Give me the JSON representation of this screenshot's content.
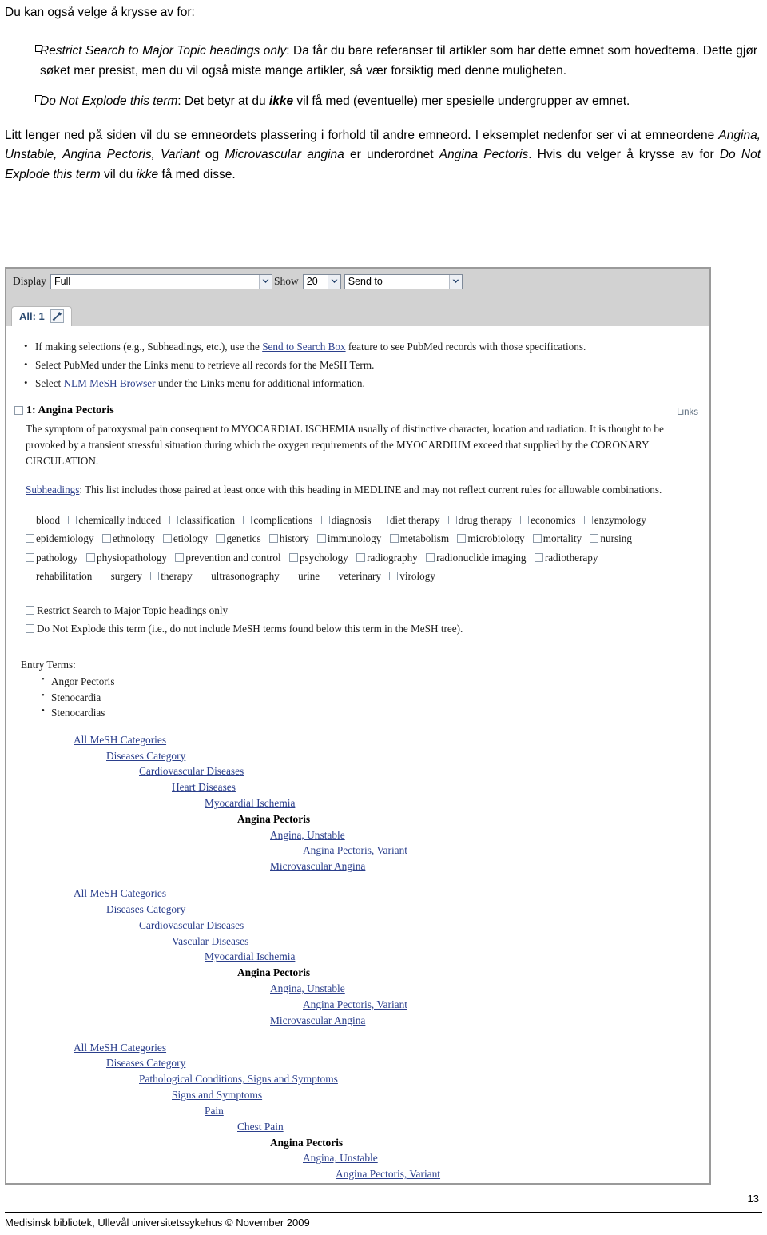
{
  "document": {
    "lead": "Du kan også velge å krysse av for:",
    "bullets": [
      {
        "term": "Restrict Search to Major Topic headings only",
        "text": ": Da får du bare referanser til artikler som har dette emnet som hovedtema. Dette gjør søket mer presist, men du vil også miste mange artikler, så vær forsiktig med denne muligheten."
      },
      {
        "term": "Do Not Explode this term",
        "text_a": ": Det betyr at du ",
        "emph": "ikke",
        "text_b": " vil få med (eventuelle) mer spesielle undergrupper av emnet."
      }
    ],
    "paragraph": {
      "p1": "Litt lenger ned på siden vil du se emneordets plassering i forhold til andre emneord. I eksemplet nedenfor ser vi at emneordene ",
      "terms1": "Angina, Unstable, Angina Pectoris, Variant",
      "p2": " og ",
      "terms2": "Microvascular angina",
      "p3": " er underordnet ",
      "terms3": "Angina Pectoris",
      "p4": ". Hvis du velger å krysse av for ",
      "terms4": "Do Not Explode this term",
      "p5": " vil du ",
      "emph": "ikke",
      "p6": " få med disse."
    }
  },
  "screenshot": {
    "toolbar": {
      "display_label": "Display",
      "display_value": "Full",
      "show_label": "Show",
      "show_value": "20",
      "sendto_value": "Send to",
      "tab_label": "All: 1",
      "wrench_icon": "wrench-icon",
      "dropdown_icon": "chevron-down-icon"
    },
    "notes": [
      {
        "pre": "If making selections (e.g., Subheadings, etc.), use the ",
        "link": "Send to Search Box",
        "post": " feature to see PubMed records with those specifications."
      },
      {
        "pre": "Select PubMed under the Links menu to retrieve all records for the MeSH Term.",
        "link": "",
        "post": ""
      },
      {
        "pre": "Select ",
        "link": "NLM MeSH Browser",
        "post": " under the Links menu for additional information."
      }
    ],
    "term": {
      "title": "1: Angina Pectoris",
      "links_label": "Links",
      "scope_line1": "The symptom of paroxysmal pain consequent to MYOCARDIAL ISCHEMIA usually of distinctive character, location and radiation.",
      "scope_line2": "It is thought to be provoked by a transient stressful situation during which the oxygen requirements of the MYOCARDIUM exceed",
      "scope_line3": "that supplied by the CORONARY CIRCULATION."
    },
    "subheadings_note": {
      "link": "Subheadings",
      "text": ": This list includes those paired at least once with this heading in MEDLINE and may not reflect current rules for allowable combinations."
    },
    "subheadings": [
      "blood",
      "chemically induced",
      "classification",
      "complications",
      "diagnosis",
      "diet therapy",
      "drug therapy",
      "economics",
      "enzymology",
      "epidemiology",
      "ethnology",
      "etiology",
      "genetics",
      "history",
      "immunology",
      "metabolism",
      "microbiology",
      "mortality",
      "nursing",
      "pathology",
      "physiopathology",
      "prevention and control",
      "psychology",
      "radiography",
      "radionuclide imaging",
      "radiotherapy",
      "rehabilitation",
      "surgery",
      "therapy",
      "ultrasonography",
      "urine",
      "veterinary",
      "virology"
    ],
    "restrictions": [
      "Restrict Search to Major Topic headings only",
      "Do Not Explode this term (i.e., do not include MeSH terms found below this term in the MeSH tree)."
    ],
    "entry_terms": {
      "title": "Entry Terms:",
      "items": [
        "Angor Pectoris",
        "Stenocardia",
        "Stenocardias"
      ]
    },
    "trees": [
      {
        "rows": [
          {
            "label": "All MeSH Categories",
            "indent": 0,
            "current": false
          },
          {
            "label": "Diseases Category",
            "indent": 1,
            "current": false
          },
          {
            "label": "Cardiovascular Diseases",
            "indent": 2,
            "current": false
          },
          {
            "label": "Heart Diseases",
            "indent": 3,
            "current": false
          },
          {
            "label": "Myocardial Ischemia",
            "indent": 4,
            "current": false
          },
          {
            "label": "Angina Pectoris",
            "indent": 5,
            "current": true
          },
          {
            "label": "Angina, Unstable",
            "indent": 6,
            "current": false
          },
          {
            "label": "Angina Pectoris, Variant",
            "indent": 7,
            "current": false
          },
          {
            "label": "Microvascular Angina",
            "indent": 6,
            "current": false
          }
        ]
      },
      {
        "rows": [
          {
            "label": "All MeSH Categories",
            "indent": 0,
            "current": false
          },
          {
            "label": "Diseases Category",
            "indent": 1,
            "current": false
          },
          {
            "label": "Cardiovascular Diseases",
            "indent": 2,
            "current": false
          },
          {
            "label": "Vascular Diseases",
            "indent": 3,
            "current": false
          },
          {
            "label": "Myocardial Ischemia",
            "indent": 4,
            "current": false
          },
          {
            "label": "Angina Pectoris",
            "indent": 5,
            "current": true
          },
          {
            "label": "Angina, Unstable",
            "indent": 6,
            "current": false
          },
          {
            "label": "Angina Pectoris, Variant",
            "indent": 7,
            "current": false
          },
          {
            "label": "Microvascular Angina",
            "indent": 6,
            "current": false
          }
        ]
      },
      {
        "rows": [
          {
            "label": "All MeSH Categories",
            "indent": 0,
            "current": false
          },
          {
            "label": "Diseases Category",
            "indent": 1,
            "current": false
          },
          {
            "label": "Pathological Conditions, Signs and Symptoms",
            "indent": 2,
            "current": false
          },
          {
            "label": "Signs and Symptoms",
            "indent": 3,
            "current": false
          },
          {
            "label": "Pain",
            "indent": 4,
            "current": false
          },
          {
            "label": "Chest Pain",
            "indent": 5,
            "current": false
          },
          {
            "label": "Angina Pectoris",
            "indent": 6,
            "current": true
          },
          {
            "label": "Angina, Unstable",
            "indent": 7,
            "current": false
          },
          {
            "label": "Angina Pectoris, Variant",
            "indent": 8,
            "current": false
          }
        ]
      }
    ]
  },
  "footer": {
    "page_number": "13",
    "text": "Medisinsk bibliotek, Ullevål universitetssykehus   ©    November 2009"
  },
  "colors": {
    "link": "#2b3f8c",
    "toolbar_bg": "#d2d2d2",
    "tab_text": "#2b4a70",
    "frame_border": "#9a9a9a"
  }
}
